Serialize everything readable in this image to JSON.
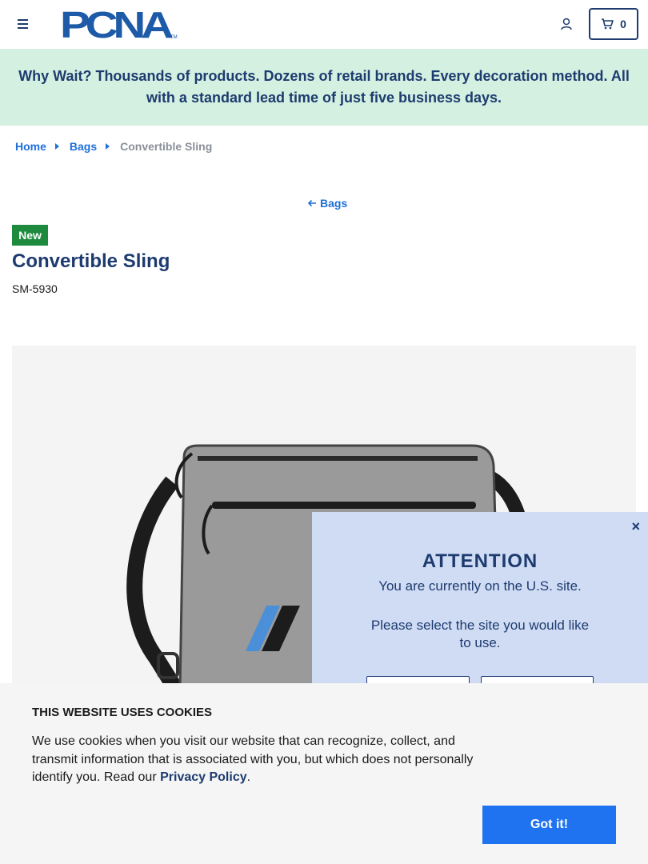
{
  "header": {
    "logo_text": "PCNA",
    "logo_tm": "TM",
    "cart_count": "0"
  },
  "banner": {
    "message": "Why Wait? Thousands of products. Dozens of retail brands. Every decoration method. All with a standard lead time of just five business days."
  },
  "breadcrumb": {
    "items": [
      "Home",
      "Bags"
    ],
    "current": "Convertible Sling"
  },
  "back_link": "Bags",
  "product": {
    "badge": "New",
    "title": "Convertible Sling",
    "sku": "SM-5930"
  },
  "attention_modal": {
    "close": "×",
    "title": "ATTENTION",
    "line1": "You are currently on the U.S. site.",
    "line2": "Please select the site you would like to use."
  },
  "cookie_banner": {
    "title": "THIS WEBSITE USES COOKIES",
    "text_before": "We use cookies when you visit our website that can recognize, collect, and transmit information that is associated with you, but which does not personally identify you. Read our ",
    "link": "Privacy Policy",
    "text_after": ".",
    "button": "Got it!"
  },
  "colors": {
    "brand_navy": "#1d3b6f",
    "link_blue": "#1e6fd9",
    "banner_green": "#d4f0e1",
    "badge_green": "#1d8a3e",
    "modal_bg": "#d0dcf4",
    "cookie_button": "#1f73f0"
  }
}
